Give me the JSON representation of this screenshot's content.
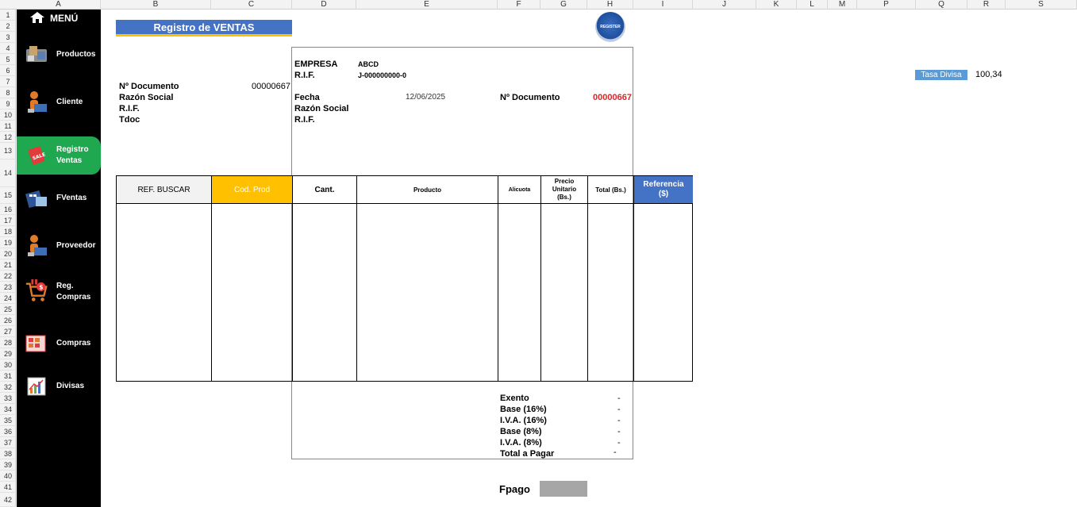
{
  "columns": [
    "A",
    "B",
    "C",
    "D",
    "E",
    "F",
    "G",
    "H",
    "I",
    "J",
    "K",
    "L",
    "M",
    "P",
    "Q",
    "R",
    "S"
  ],
  "rows": [
    "1",
    "2",
    "3",
    "4",
    "5",
    "6",
    "7",
    "8",
    "9",
    "10",
    "11",
    "12",
    "13",
    "14",
    "15",
    "16",
    "17",
    "18",
    "19",
    "20",
    "21",
    "22",
    "23",
    "24",
    "25",
    "26",
    "27",
    "28",
    "29",
    "30",
    "31",
    "32",
    "33",
    "34",
    "35",
    "36",
    "37",
    "38",
    "39",
    "40",
    "41",
    "42"
  ],
  "sidebar": {
    "menu_label": "MENÚ",
    "items": [
      {
        "label": "Productos",
        "icon": "products-icon"
      },
      {
        "label": "Cliente",
        "icon": "client-icon"
      },
      {
        "label": "Registro\nVentas",
        "line1": "Registro",
        "line2": "Ventas",
        "icon": "sale-tag-icon",
        "active": true
      },
      {
        "label": "FVentas",
        "icon": "calculator-icon"
      },
      {
        "label": "Proveedor",
        "icon": "supplier-icon"
      },
      {
        "label": "Reg. Compras",
        "line1": "Reg.",
        "line2": "Compras",
        "icon": "shopping-cart-icon"
      },
      {
        "label": "Compras",
        "icon": "purchases-icon"
      },
      {
        "label": "Divisas",
        "icon": "chart-icon"
      }
    ]
  },
  "sheet": {
    "title": "Registro de VENTAS",
    "register_badge": "REGISTER",
    "left": {
      "doc_label": "Nº Documento",
      "doc_value": "00000667",
      "razon_label": "Razón Social",
      "rif_label": "R.I.F.",
      "tdoc_label": "Tdoc"
    },
    "empresa": {
      "empresa_label": "EMPRESA",
      "empresa_value": "ABCD",
      "rif_label": "R.I.F.",
      "rif_value": "J-000000000-0"
    },
    "factura": {
      "fecha_label": "Fecha",
      "fecha_value": "12/06/2025",
      "doc_label": "Nº Documento",
      "doc_value": "00000667",
      "razon_label": "Razón Social",
      "rif_label": "R.I.F."
    },
    "tasa": {
      "label": "Tasa Divisa",
      "value": "100,34"
    },
    "table_headers": {
      "ref_buscar": "REF. BUSCAR",
      "cod_prod": "Cod. Prod",
      "cant": "Cant.",
      "producto": "Producto",
      "alicuota": "Alicuota",
      "precio": "Precio Unitario (Bs.)",
      "total": "Total (Bs.)",
      "referencia": "Referencia ($)"
    },
    "totals": [
      {
        "label": "Exento",
        "value": "-"
      },
      {
        "label": "Base (16%)",
        "value": "-"
      },
      {
        "label": "I.V.A. (16%)",
        "value": "-"
      },
      {
        "label": "Base (8%)",
        "value": "-"
      },
      {
        "label": "I.V.A. (8%)",
        "value": "-"
      },
      {
        "label": "Total a Pagar",
        "value": "-"
      }
    ],
    "fpago_label": "Fpago",
    "colors": {
      "title_blue": "#4472c4",
      "accent_gold": "#ffc000",
      "active_green": "#1fa84f",
      "doc_red": "#d9262b",
      "tasa_blue": "#5b9bd5"
    }
  }
}
